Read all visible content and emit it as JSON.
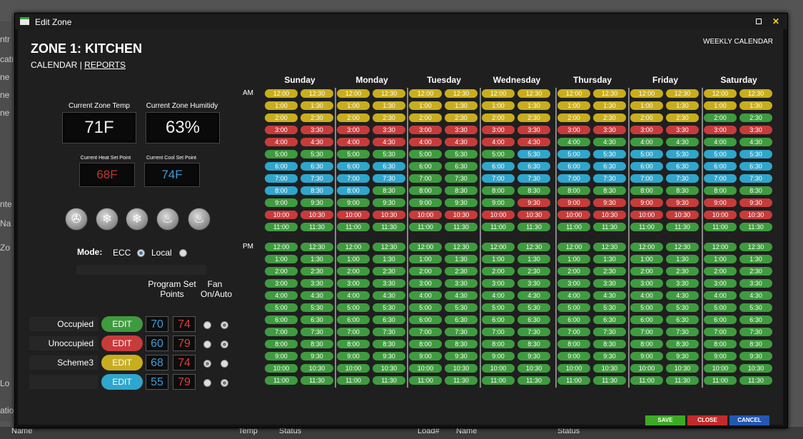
{
  "background": {
    "left_labels": [
      "ntr",
      "cati",
      "ne",
      "ne",
      "ne",
      "nte",
      "Na",
      "Zo",
      "Lo",
      "atio"
    ],
    "bottom_labels": [
      "Name",
      "Temp",
      "Status",
      "Load#",
      "Name",
      "Status"
    ]
  },
  "window": {
    "title": "Edit Zone"
  },
  "zone": {
    "title": "ZONE 1: KITCHEN",
    "crumb_calendar": "CALENDAR",
    "crumb_sep": " | ",
    "crumb_reports": "REPORTS",
    "weekly_label": "WEEKLY CALENDAR"
  },
  "readings": {
    "temp_label": "Current Zone Temp",
    "temp_value": "71F",
    "humidity_label": "Current Zone Humitidy",
    "humidity_value": "63%",
    "heat_label": "Current Heat Set Point",
    "heat_value": "68F",
    "cool_label": "Current Cool Set Point",
    "cool_value": "74F"
  },
  "mode_buttons": [
    "fan-icon",
    "snowflake-icon",
    "snowflake-icon",
    "flame-icon",
    "flame-icon"
  ],
  "mode": {
    "label": "Mode:",
    "ecc_label": "ECC",
    "local_label": "Local",
    "selected": "ECC"
  },
  "schedule_headers": {
    "program": "Program Set Points",
    "fan": "Fan On/Auto"
  },
  "schemes": [
    {
      "name": "Occupied",
      "edit": "EDIT",
      "color": "#3f9b3f",
      "heat": "70",
      "cool": "74"
    },
    {
      "name": "Unoccupied",
      "edit": "EDIT",
      "color": "#c83b3b",
      "heat": "60",
      "cool": "79"
    },
    {
      "name": "Scheme3",
      "edit": "EDIT",
      "color": "#c8ae1e",
      "heat": "68",
      "cool": "74"
    },
    {
      "name": "",
      "edit": "EDIT",
      "color": "#2fa6cc",
      "heat": "55",
      "cool": "79"
    }
  ],
  "calendar": {
    "am_label": "AM",
    "pm_label": "PM",
    "days": [
      "Sunday",
      "Monday",
      "Tuesday",
      "Wednesday",
      "Thursday",
      "Friday",
      "Saturday"
    ],
    "am_times": [
      "12:00",
      "12:30",
      "1:00",
      "1:30",
      "2:00",
      "2:30",
      "3:00",
      "3:30",
      "4:00",
      "4:30",
      "5:00",
      "5:30",
      "6:00",
      "6:30",
      "7:00",
      "7:30",
      "8:00",
      "8:30",
      "9:00",
      "9:30",
      "10:00",
      "10:30",
      "11:00",
      "11:30"
    ],
    "pm_times": [
      "12:00",
      "12:30",
      "1:00",
      "1:30",
      "2:00",
      "2:30",
      "3:00",
      "3:30",
      "4:00",
      "4:30",
      "5:00",
      "5:30",
      "6:00",
      "6:30",
      "7:00",
      "7:30",
      "8:00",
      "8:30",
      "9:00",
      "9:30",
      "10:00",
      "10:30",
      "11:00",
      "11:30"
    ],
    "colors": {
      "g": "#3f9b3f",
      "r": "#c83b3b",
      "y": "#c8ae1e",
      "b": "#2fa6cc"
    },
    "am_pattern": [
      [
        "y",
        "y",
        "y",
        "y",
        "y",
        "y",
        "r",
        "r",
        "r",
        "r",
        "g",
        "g",
        "b",
        "b",
        "b",
        "b",
        "b",
        "b",
        "g",
        "g",
        "r",
        "r",
        "g",
        "g"
      ],
      [
        "y",
        "y",
        "y",
        "y",
        "y",
        "y",
        "r",
        "r",
        "r",
        "r",
        "g",
        "g",
        "b",
        "b",
        "b",
        "b",
        "b",
        "g",
        "g",
        "g",
        "r",
        "r",
        "g",
        "g"
      ],
      [
        "y",
        "y",
        "y",
        "y",
        "y",
        "y",
        "r",
        "r",
        "r",
        "r",
        "g",
        "g",
        "g",
        "g",
        "g",
        "g",
        "g",
        "g",
        "g",
        "g",
        "r",
        "r",
        "g",
        "g"
      ],
      [
        "y",
        "y",
        "y",
        "y",
        "y",
        "y",
        "r",
        "r",
        "r",
        "r",
        "g",
        "b",
        "b",
        "b",
        "b",
        "b",
        "g",
        "g",
        "g",
        "r",
        "r",
        "r",
        "g",
        "g"
      ],
      [
        "y",
        "y",
        "y",
        "y",
        "y",
        "y",
        "r",
        "r",
        "g",
        "g",
        "b",
        "b",
        "b",
        "b",
        "b",
        "b",
        "g",
        "g",
        "r",
        "r",
        "r",
        "r",
        "g",
        "g"
      ],
      [
        "y",
        "y",
        "y",
        "y",
        "y",
        "y",
        "r",
        "r",
        "g",
        "g",
        "b",
        "b",
        "b",
        "b",
        "b",
        "b",
        "g",
        "g",
        "r",
        "r",
        "r",
        "r",
        "g",
        "g"
      ],
      [
        "y",
        "y",
        "y",
        "y",
        "g",
        "g",
        "r",
        "r",
        "g",
        "g",
        "b",
        "b",
        "b",
        "b",
        "b",
        "b",
        "g",
        "g",
        "r",
        "r",
        "r",
        "r",
        "g",
        "g"
      ]
    ],
    "pm_color": "g"
  },
  "footer": {
    "save": "SAVE",
    "close": "CLOSE",
    "cancel": "CANCEL"
  }
}
